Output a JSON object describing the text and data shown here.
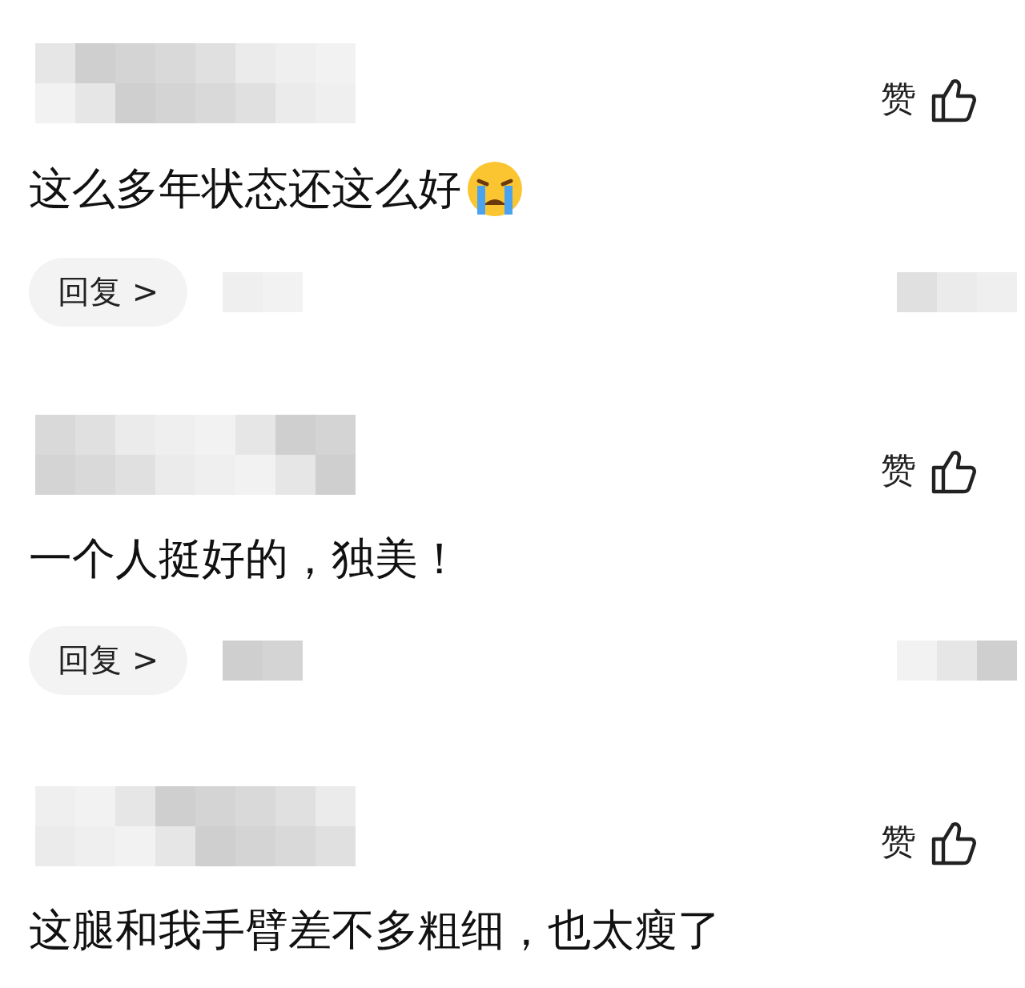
{
  "comments": [
    {
      "like_label": "赞",
      "text": "这么多年状态还这么好",
      "emoji": {
        "kind": "crying"
      },
      "reply": {
        "label": "回复 >"
      }
    },
    {
      "like_label": "赞",
      "text": "一个人挺好的，独美！",
      "reply": {
        "label": "回复 >"
      }
    },
    {
      "like_label": "赞",
      "text": "这腿和我手臂差不多粗细，也太瘦了"
    }
  ]
}
